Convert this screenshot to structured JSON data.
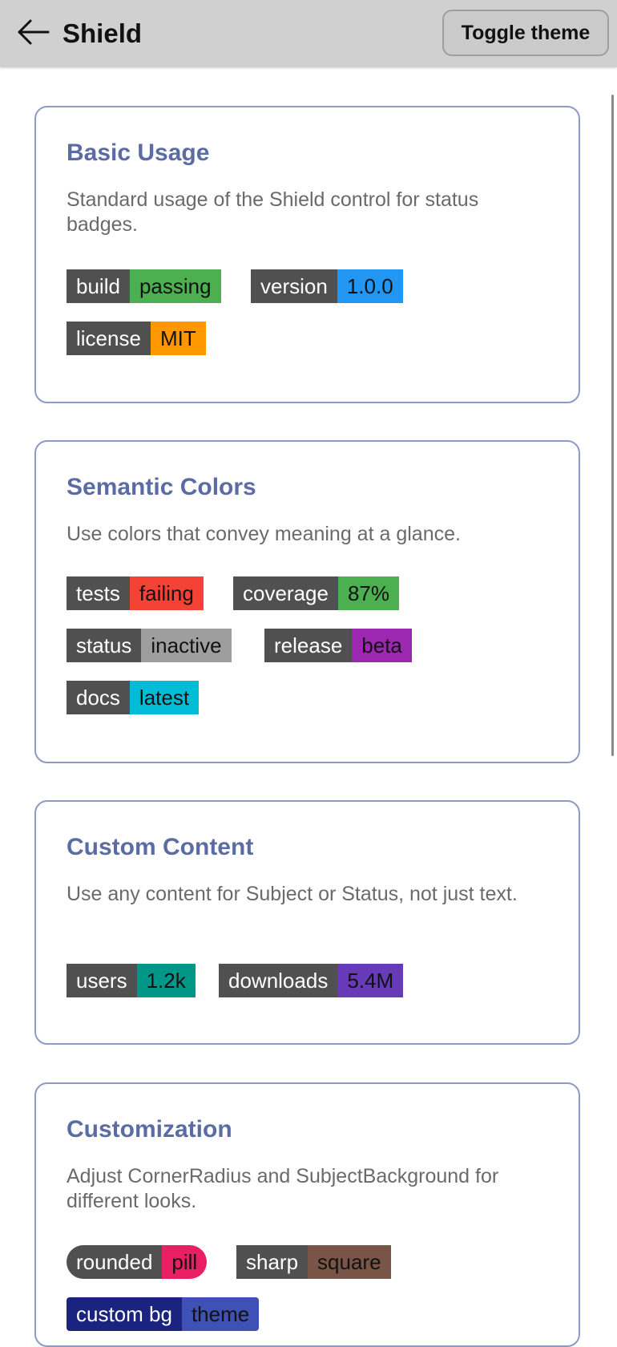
{
  "header": {
    "title": "Shield",
    "toggle_label": "Toggle theme",
    "back_icon": "arrow-left-icon"
  },
  "colors": {
    "header_bg": "#d0d0d0",
    "card_border": "#8e99c6",
    "card_title": "#5b6ba4",
    "subject_bg": "#505050"
  },
  "sections": [
    {
      "title": "Basic Usage",
      "description": "Standard usage of the Shield control for status badges.",
      "shields": [
        {
          "subject": "build",
          "status": "passing",
          "color": "#4caf50"
        },
        {
          "subject": "version",
          "status": "1.0.0",
          "color": "#2196f3"
        },
        {
          "subject": "license",
          "status": "MIT",
          "color": "#ff9800"
        }
      ]
    },
    {
      "title": "Semantic Colors",
      "description": "Use colors that convey meaning at a glance.",
      "shields": [
        {
          "subject": "tests",
          "status": "failing",
          "color": "#f44336"
        },
        {
          "subject": "coverage",
          "status": "87%",
          "color": "#4caf50"
        },
        {
          "subject": "status",
          "status": "inactive",
          "color": "#9e9e9e"
        },
        {
          "subject": "release",
          "status": "beta",
          "color": "#9c27b0"
        },
        {
          "subject": "docs",
          "status": "latest",
          "color": "#00bcd4"
        }
      ]
    },
    {
      "title": "Custom Content",
      "description": "Use any content for Subject or Status, not just text.",
      "shields": [
        {
          "subject": "users",
          "status": "1.2k",
          "color": "#009688"
        },
        {
          "subject": "downloads",
          "status": "5.4M",
          "color": "#673ab7"
        }
      ]
    },
    {
      "title": "Customization",
      "description": "Adjust CornerRadius and SubjectBackground for different looks.",
      "shields": [
        {
          "subject": "rounded",
          "status": "pill",
          "color": "#e91e63"
        },
        {
          "subject": "sharp",
          "status": "square",
          "color": "#795548"
        },
        {
          "subject": "custom bg",
          "status": "theme",
          "color": "#3f51b5",
          "subject_bg": "#1a237e"
        }
      ]
    }
  ]
}
